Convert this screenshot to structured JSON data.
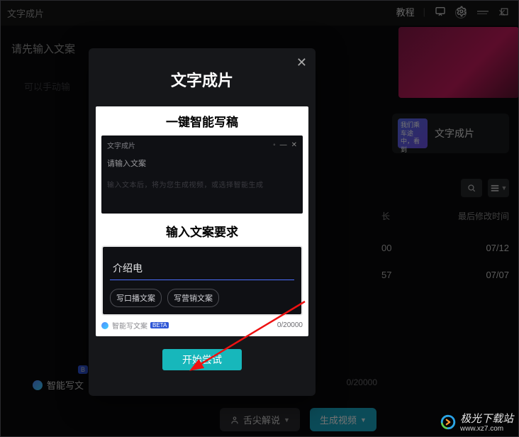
{
  "app": {
    "title": "文字成片",
    "sys": {
      "min": "—",
      "close": "✕"
    }
  },
  "host": {
    "tab": "教程"
  },
  "bg": {
    "prompt": "请先输入文案",
    "sub": "可以手动输",
    "chip_label": "智能写文",
    "badge": "B",
    "counter": "0/20000",
    "action_narrate": "舌尖解说",
    "action_generate": "生成视频"
  },
  "right": {
    "card_thumb_text": "我们乘车途中，看到",
    "card_title": "文字成片",
    "col_len": "长",
    "col_mtime": "最后修改时间",
    "rows": [
      {
        "len": "00",
        "mtime": "07/12"
      },
      {
        "len": "57",
        "mtime": "07/07"
      }
    ]
  },
  "modal": {
    "title": "文字成片",
    "section1": "一键智能写稿",
    "mock_title": "文字成片",
    "mock_prompt": "请输入文案",
    "mock_hint": "输入文本后，将为您生成视频，或选择智能生成",
    "section2": "输入文案要求",
    "input_value": "介绍电",
    "chip1": "写口播文案",
    "chip2": "写营销文案",
    "footer_label": "智能写文案",
    "footer_beta": "BETA",
    "footer_count": "0/20000",
    "start": "开始尝试"
  },
  "watermark": {
    "name": "极光下载站",
    "url": "www.xz7.com"
  }
}
